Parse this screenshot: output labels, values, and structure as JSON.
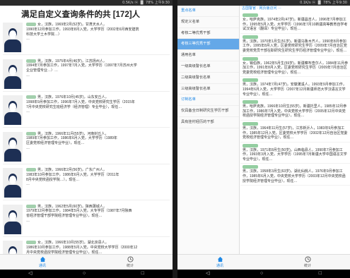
{
  "left": {
    "status": "0.5K/s ⓦ ▐▌ 78% 上午9:30",
    "title": "满足自定义查询条件的共 [172]人",
    "cards": [
      {
        "line1": "女，汉族，1969年2月(52岁)，甘肃天水人，",
        "line2": "1990年12月参加工作，1993年8月入党，大学学历（2002年6月西安建筑",
        "line3": "科技大学土木学院…）",
        "line4": "…"
      },
      {
        "line1": "男，汉族，1975年4月(46岁)，江苏扬州人，",
        "line2": "1994年7月参加工作，1997年7月入党，大学学历（1997年7月苏州大学",
        "line3": "企业管理专业…）…",
        "line4": "…"
      },
      {
        "line1": "男，汉族，1976年10月(45岁)，山东安丘人，",
        "line2": "1998年9月参加工作，1996年7月入党，中央党校研究生学历（2015年",
        "line3": "7月中央党校研究生班经济学（经济管理）专业毕业），现任…",
        "line4": "…"
      },
      {
        "line1": "男，汉族，1966年11月(55岁)，河南封丘人，",
        "line2": "1989年7月参加工作，1986年6月入党，大学学历（1989年",
        "line3": "区委党校经济管理专业毕业），现任…",
        "line4": "…"
      },
      {
        "line1": "男，汉族，1966年2月(56岁)，广东广州人，",
        "line2": "1983年10月参加工作，1986年6月入党，大学学历（2011年",
        "line3": "8月中央党校函授学院…），现任…",
        "line4": "…"
      },
      {
        "line1": "男，汉族，1962年5月(60岁)，陕西蒲城人，",
        "line2": "1979年12月参加工作，1984年5月入党，大专学历（1987年7月陕西",
        "line3": "省经济管理干部学院经济管理专业毕业），现任…",
        "line4": "…"
      },
      {
        "line1": "女，汉族，1966年10月(55岁)，湖北京县人，",
        "line2": "1986年10月参加工作，1988年5月入党，中央党校大学学历（2000年12",
        "line3": "月中央党校函授学院经济管理专业毕业），现任…",
        "line4": "…"
      }
    ],
    "tabs": [
      {
        "label": "通讯"
      },
      {
        "label": "统计"
      }
    ],
    "nav": {
      "back": "◁",
      "home": "○",
      "recent": "□"
    }
  },
  "right": {
    "status": "0.1K/s ⓦ ▐▌ 78% 上午9:30",
    "menu": [
      {
        "label": "重点名单",
        "type": "header"
      },
      {
        "label": "规定义名单",
        "type": "normal"
      },
      {
        "label": "考核二等优秀干部",
        "type": "normal"
      },
      {
        "label": "考核三等优秀干部",
        "type": "active"
      },
      {
        "label": "通用名单",
        "type": "normal"
      },
      {
        "label": "一级高级警长名单",
        "type": "normal"
      },
      {
        "label": "二级高级警长名单",
        "type": "normal"
      },
      {
        "label": "三级高级警长名单",
        "type": "normal"
      },
      {
        "label": "订制名单",
        "type": "section"
      },
      {
        "label": "仅具备全日制研究生学历干部",
        "type": "normal"
      },
      {
        "label": "具有挂村经历的干部",
        "type": "normal"
      }
    ],
    "content_header": "古国警官 · 网页版访问 ···",
    "entries": [
      {
        "text": "女，哈萨克族，1974年2月(47岁)，新疆昌吉人，1996年7月参加工作，1995年5月入党，大学学历（1996年7月10新疆高等教育自学考试汉语言（翻译）专业毕业），现任…"
      },
      {
        "text": "男，汉族，1970年1月生(51岁)，新疆乌鲁木齐人，1990年8月参加工作，1995年8月入党，区委党校研究生学历（2009年7月自治区党委党校党员干部在职研究生研究生学历经济管理专业毕业），现任…"
      },
      {
        "text": "女，锡伯族，1962年5月生(59岁)，新疆察布查尔人，1984年11月参加工作，1991年8月入党，区委党校研究生学历（2009年7月自治区党委党校经济管理专业毕业），现任…"
      },
      {
        "text": "男，汉族，1974年7月(47岁)，安徽濉溪人，1993年9月参加工作，1994年6月入党，大学学历（2007年12月新疆师范大学汉语言文学专业毕业），现任…"
      },
      {
        "text": "男，哈萨克族，1966年10月生(55岁)，新疆托里人，1985年12月参加工作，1986年7月入党，中央党校大学学历（2005年12月中央党校函授学院经济管理专业毕业），现任…"
      },
      {
        "text": "男，汉族，1964年11月生(57岁)，江苏新沂人，1983年9月参加工作，1985年12月入党，区委党校大学学历（2002年12月自治区党委党校经济管理专业毕业），现任…"
      },
      {
        "text": "男，汉族，1971年8月生(50岁)，山西临县人，1990年7月参加工作，1993年3月入党，大学学历（1995年7月新疆大学中国语言文学专业毕业），现任…"
      },
      {
        "text": "男，汉族，1958年3月生(63岁)，湖北仙桃人，1976年9月参加工作，1985年6月入党，中央党校大学学历（2003年12月中央党校函授学院经济管理专业毕业），现任…"
      }
    ],
    "tabs": [
      {
        "label": "通讯"
      },
      {
        "label": "统计"
      }
    ],
    "nav": {
      "back": "◁",
      "home": "○",
      "recent": "□"
    }
  }
}
